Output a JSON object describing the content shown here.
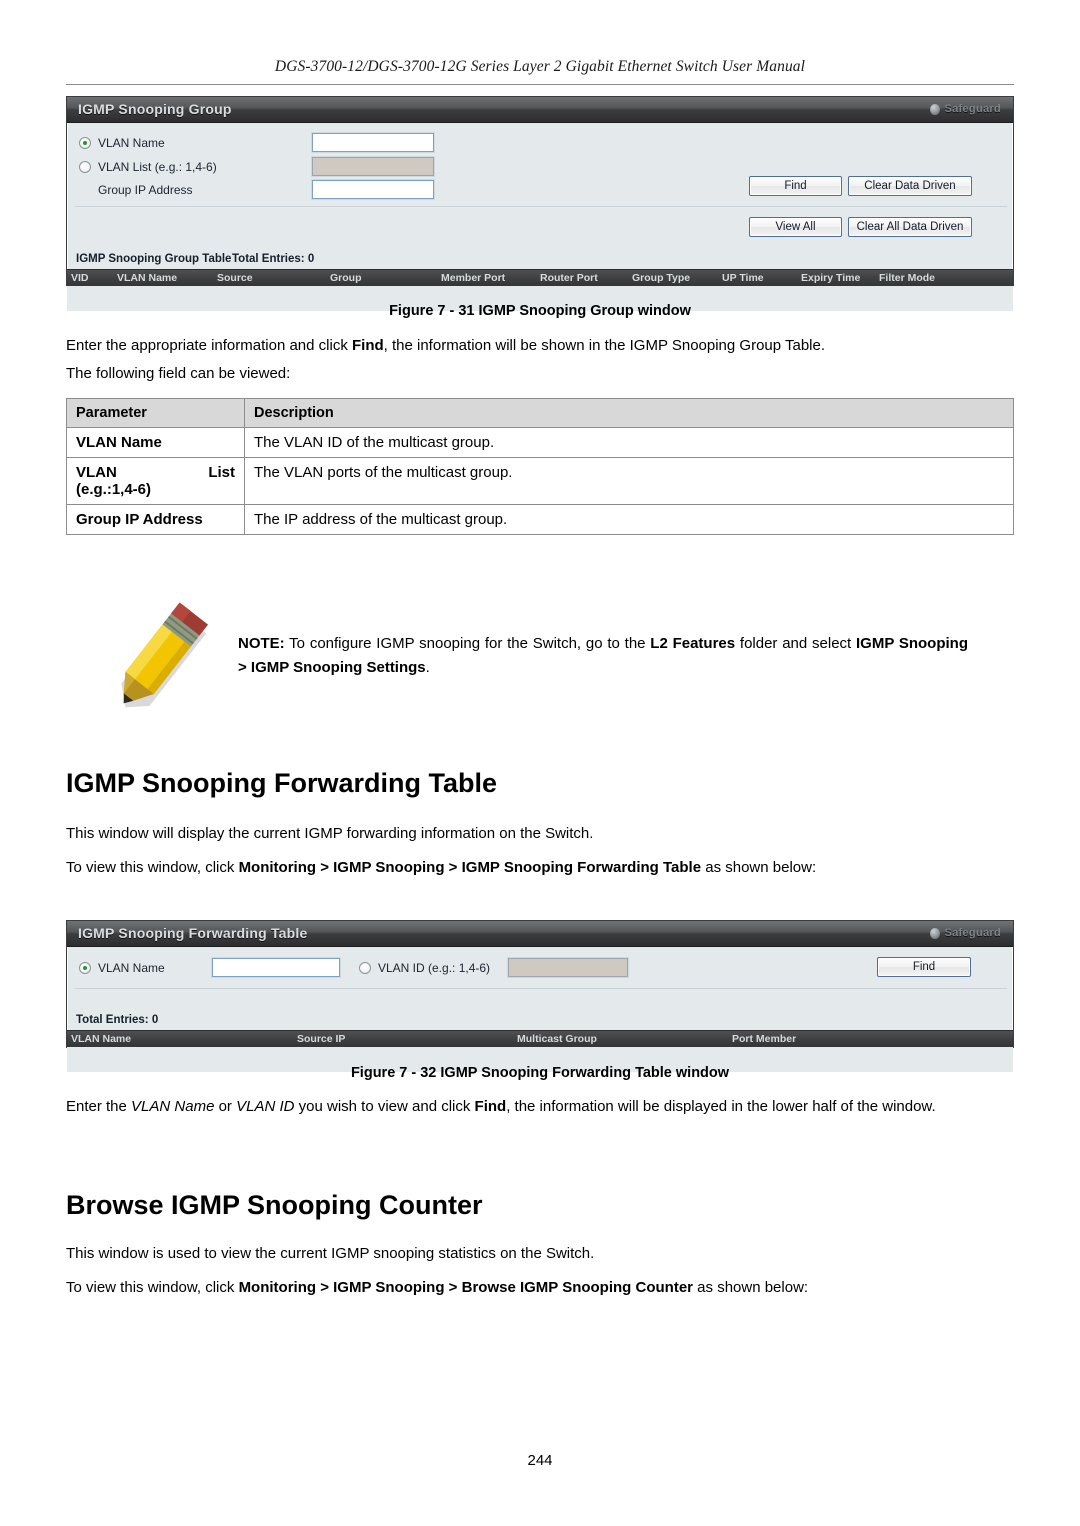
{
  "header": {
    "manual_title": "DGS-3700-12/DGS-3700-12G Series Layer 2 Gigabit Ethernet Switch User Manual"
  },
  "panel1": {
    "title": "IGMP Snooping Group",
    "safeguard_label": "Safeguard",
    "radio_vlan_name": "VLAN Name",
    "radio_vlan_list": "VLAN List (e.g.: 1,4-6)",
    "label_group_ip": "Group IP Address",
    "vlan_name_value": "",
    "vlan_list_value": "",
    "group_ip_value": "",
    "btn_find": "Find",
    "btn_clear_data_driven": "Clear Data Driven",
    "btn_view_all": "View All",
    "btn_clear_all_data_driven": "Clear All Data Driven",
    "table_title": "IGMP Snooping Group Table",
    "total_entries": "Total Entries: 0",
    "columns": [
      "VID",
      "VLAN Name",
      "Source",
      "Group",
      "Member Port",
      "Router Port",
      "Group Type",
      "UP Time",
      "Expiry Time",
      "Filter Mode"
    ]
  },
  "figure1": {
    "caption": "Figure 7 - 31 IGMP Snooping Group window"
  },
  "intro": {
    "line1_a": "Enter the appropriate information and click ",
    "line1_b": "Find",
    "line1_c": ", the information will be shown in the IGMP Snooping Group Table.",
    "line2": "The following field can be viewed:"
  },
  "param_table": {
    "header": {
      "parameter": "Parameter",
      "description": "Description"
    },
    "rows": [
      {
        "name": "VLAN Name",
        "name2": "",
        "name_sub": "",
        "desc": "The VLAN ID of the multicast group."
      },
      {
        "name": "VLAN",
        "name2": "List",
        "name_sub": "(e.g.:1,4-6)",
        "desc": "The VLAN ports of the multicast group."
      },
      {
        "name": "Group IP Address",
        "name2": "",
        "name_sub": "",
        "desc": "The IP address of the multicast group."
      }
    ]
  },
  "note": {
    "label": "NOTE:",
    "text_a": " To configure IGMP snooping for the Switch, go to the ",
    "bold1": "L2 Features",
    "text_b": " folder and select ",
    "bold2": "IGMP Snooping > IGMP Snooping Settings",
    "text_c": "."
  },
  "section_forwarding": {
    "heading": "IGMP Snooping Forwarding Table",
    "para1": "This window will display the current IGMP forwarding information on the Switch.",
    "para2_a": "To view this window, click ",
    "para2_b": "Monitoring > IGMP Snooping > IGMP Snooping Forwarding Table",
    "para2_c": " as shown below:"
  },
  "panel2": {
    "title": "IGMP Snooping Forwarding Table",
    "safeguard_label": "Safeguard",
    "radio_vlan_name": "VLAN Name",
    "radio_vlan_id": "VLAN ID (e.g.: 1,4-6)",
    "vlan_name_value": "",
    "vlan_id_value": "",
    "btn_find": "Find",
    "total_entries": "Total Entries: 0",
    "columns": [
      "VLAN Name",
      "Source IP",
      "Multicast Group",
      "Port Member"
    ]
  },
  "figure2": {
    "caption": "Figure 7 - 32 IGMP Snooping Forwarding Table window"
  },
  "after_fig2": {
    "a": "Enter the ",
    "i1": "VLAN Name",
    "b": " or  ",
    "i2": "VLAN ID",
    "c": " you wish to view and click ",
    "bold": "Find",
    "d": ", the information will be displayed in the lower half of the window."
  },
  "section_counter": {
    "heading": "Browse IGMP Snooping Counter",
    "para1": "This window is used to view the current IGMP snooping statistics on the Switch.",
    "para2_a": "To view this window, click ",
    "para2_b": "Monitoring > IGMP Snooping > Browse IGMP Snooping Counter",
    "para2_c": " as shown below:"
  },
  "footer": {
    "page_number": "244"
  },
  "colors": {
    "panel_bg": "#e4eaec",
    "titlebar_dark": "#2b2d2f",
    "radio_selected": "#1f9a23",
    "table_header": "#3e4042",
    "disabled_field": "#cfc9c1"
  }
}
